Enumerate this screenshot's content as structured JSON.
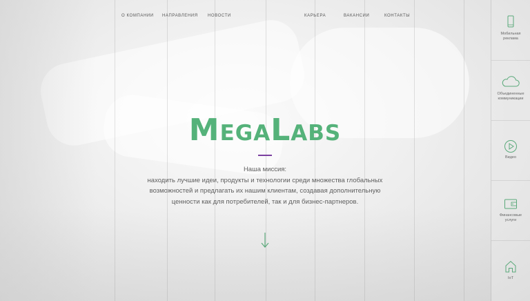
{
  "nav": {
    "items": [
      "О КОМПАНИИ",
      "НАПРАВЛЕНИЯ",
      "НОВОСТИ",
      "КАРЬЕРА",
      "ВАКАНСИИ",
      "КОНТАКТЫ"
    ]
  },
  "hero": {
    "logo": "MegaLabs",
    "mission_title": "Наша миссия:",
    "mission_lines": [
      "находить лучшие идеи, продукты и технологии среди множества глобальных",
      "возможностей и предлагать их нашим клиентам, создавая дополнительную",
      "ценности как для потребителей, так и для бизнес-партнеров."
    ]
  },
  "sidebar": {
    "items": [
      {
        "label_1": "Мобильная",
        "label_2": "реклама",
        "icon": "mobile-phone-icon"
      },
      {
        "label_1": "Объединенные",
        "label_2": "коммуникации",
        "icon": "cloud-icon"
      },
      {
        "label_1": "Видео",
        "label_2": "",
        "icon": "play-icon"
      },
      {
        "label_1": "Финансовые",
        "label_2": "услуги",
        "icon": "wallet-icon"
      },
      {
        "label_1": "IoT",
        "label_2": "",
        "icon": "home-icon"
      }
    ]
  },
  "colors": {
    "brand_green": "#55b27a",
    "accent_purple": "#7a3fa0",
    "icon_green": "#5aa97a"
  }
}
